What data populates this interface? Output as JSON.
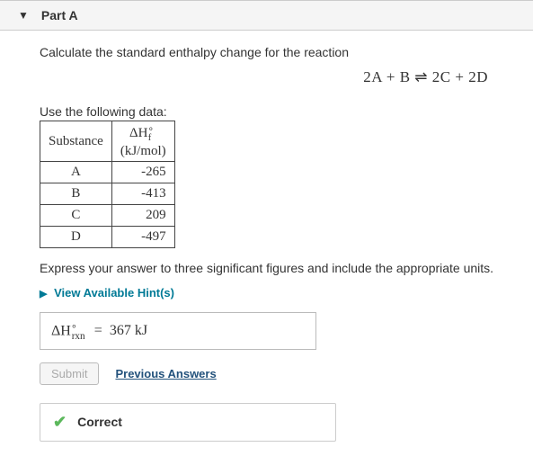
{
  "part": {
    "label": "Part A"
  },
  "question": {
    "prompt": "Calculate the standard enthalpy change for the reaction",
    "equation": "2A + B ⇌ 2C + 2D",
    "data_intro": "Use the following data:",
    "table": {
      "col1": "Substance",
      "col2_top": "ΔH",
      "col2_sup": "∘",
      "col2_sub": "f",
      "col2_unit": "(kJ/mol)",
      "rows": [
        {
          "name": "A",
          "value": "-265"
        },
        {
          "name": "B",
          "value": "-413"
        },
        {
          "name": "C",
          "value": "209"
        },
        {
          "name": "D",
          "value": "-497"
        }
      ]
    },
    "instruction": "Express your answer to three significant figures and include the appropriate units."
  },
  "hints": {
    "label": "View Available Hint(s)"
  },
  "answer": {
    "symbol_base": "ΔH",
    "symbol_sup": "∘",
    "symbol_sub": "rxn",
    "equals": "=",
    "value": "367 kJ"
  },
  "actions": {
    "submit": "Submit",
    "previous_answers": "Previous Answers"
  },
  "feedback": {
    "status": "Correct"
  }
}
